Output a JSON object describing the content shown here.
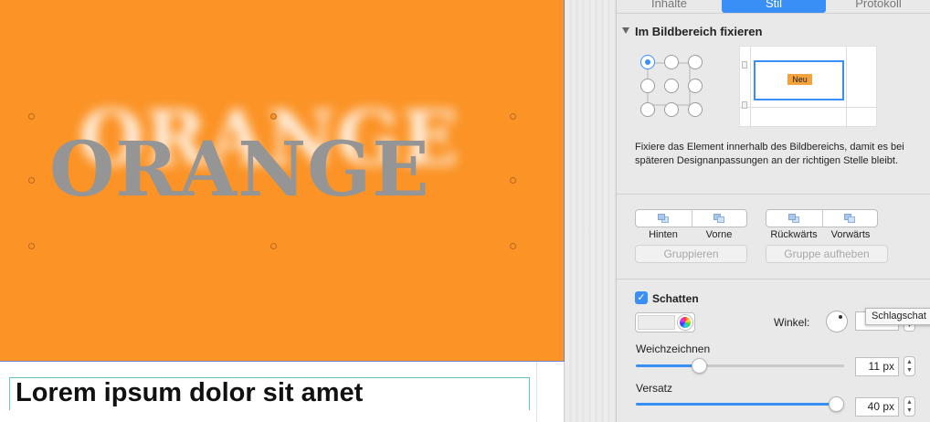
{
  "canvas": {
    "headline": "ORANGE",
    "body_text": "Lorem ipsum dolor sit amet"
  },
  "inspector": {
    "tabs": [
      {
        "label": "Inhalte",
        "active": false
      },
      {
        "label": "Stil",
        "active": true
      },
      {
        "label": "Protokoll",
        "active": false
      }
    ],
    "fix": {
      "title": "Im Bildbereich fixieren",
      "preview_label": "Neu",
      "description": "Fixiere das Element innerhalb des Bildbereichs, damit es bei späteren Designanpassungen an der richtigen Stelle bleibt."
    },
    "arrange": {
      "hinten": "Hinten",
      "vorne": "Vorne",
      "rueckwaerts": "Rückwärts",
      "vorwaerts": "Vorwärts",
      "gruppieren": "Gruppieren",
      "gruppe_aufheben": "Gruppe aufheben"
    },
    "shadow": {
      "label": "Schatten",
      "checked": true,
      "winkel_label": "Winkel:",
      "winkel_value": "45",
      "tooltip": "Schlagschat",
      "blur_label": "Weichzeichnen",
      "blur_value": "11 px",
      "blur_fraction": 0.29,
      "offset_label": "Versatz",
      "offset_value": "40 px",
      "offset_fraction": 1.0
    },
    "colors": {
      "accent": "#3a8ff6",
      "orange": "#fb9326"
    }
  }
}
